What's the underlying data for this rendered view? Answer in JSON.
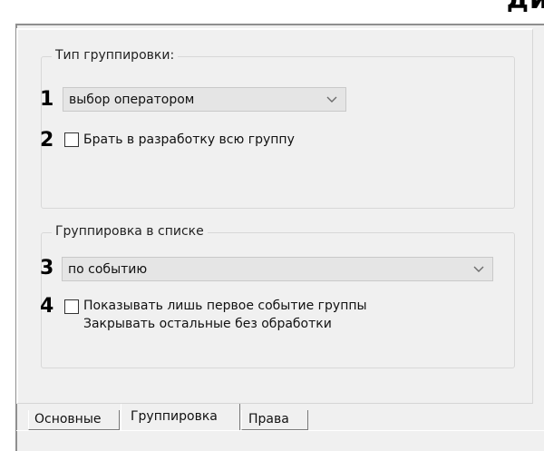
{
  "top_cut_text": "ди",
  "group_type": {
    "legend": "Тип группировки:",
    "number_1": "1",
    "select_value": "выбор оператором",
    "number_2": "2",
    "checkbox_label": "Брать в разработку всю группу"
  },
  "list_grouping": {
    "legend": "Группировка в списке",
    "number_3": "3",
    "select_value": "по событию",
    "number_4": "4",
    "checkbox_label_line1": "Показывать лишь первое событие группы",
    "checkbox_label_line2": "Закрывать остальные без обработки"
  },
  "tabs": {
    "basic": "Основные",
    "grouping": "Группировка",
    "rights": "Права"
  },
  "icons": {
    "dropdown": "chevron-down-icon",
    "checkbox": "checkbox-unchecked"
  }
}
